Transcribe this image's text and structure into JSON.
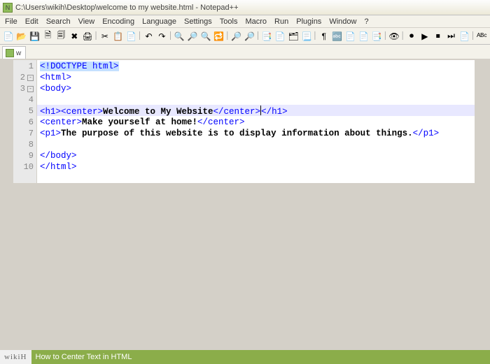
{
  "window": {
    "title": "C:\\Users\\wikih\\Desktop\\welcome to my website.html - Notepad++"
  },
  "menu": [
    "File",
    "Edit",
    "Search",
    "View",
    "Encoding",
    "Language",
    "Settings",
    "Tools",
    "Macro",
    "Run",
    "Plugins",
    "Window",
    "?"
  ],
  "toolbar_icons": [
    "📄",
    "📂",
    "💾",
    "🗎",
    "🗐",
    "✖",
    "🖨",
    "|",
    "✂",
    "📋",
    "📄",
    "|",
    "↶",
    "↷",
    "|",
    "🔍",
    "🔎",
    "🔍",
    "🔁",
    "|",
    "🔎",
    "🔎",
    "|",
    "📑",
    "📄",
    "🗂",
    "📃",
    "|",
    "¶",
    "🔤",
    "📄",
    "📄",
    "📑",
    "|",
    "👁",
    "|",
    "⏺",
    "▶",
    "⏹",
    "⏭",
    "📄",
    "|",
    "ᴬᴮᶜ"
  ],
  "tab": {
    "label": "w"
  },
  "gutter": {
    "lines": [
      "1",
      "2",
      "3",
      "4",
      "5",
      "6",
      "7",
      "8",
      "9",
      "10"
    ],
    "fold_rows": [
      1,
      2
    ],
    "fold_glyph": "-"
  },
  "code": {
    "active_row": 4,
    "rows": [
      [
        {
          "cls": "t-blue t-doctype",
          "txt": "<!DOCTYPE html>"
        }
      ],
      [
        {
          "cls": "t-blue",
          "txt": "<html>"
        }
      ],
      [
        {
          "cls": "t-blue",
          "txt": "<body>"
        }
      ],
      [],
      [
        {
          "cls": "t-blue",
          "txt": "<h1><center>"
        },
        {
          "cls": "t-black",
          "txt": "Welcome to My Website"
        },
        {
          "cls": "t-blue",
          "txt": "</center>"
        },
        {
          "caret": true
        },
        {
          "cls": "t-blue",
          "txt": "</h1>"
        }
      ],
      [
        {
          "cls": "t-blue",
          "txt": "<center>"
        },
        {
          "cls": "t-black",
          "txt": "Make yourself at home!"
        },
        {
          "cls": "t-blue",
          "txt": "</center>"
        }
      ],
      [
        {
          "cls": "t-blue",
          "txt": "<p1>"
        },
        {
          "cls": "t-black",
          "txt": "The purpose of this website is to display information about things."
        },
        {
          "cls": "t-blue",
          "txt": "</p1>"
        }
      ],
      [],
      [
        {
          "cls": "t-blue",
          "txt": "</body>"
        }
      ],
      [
        {
          "cls": "t-blue",
          "txt": "</html>"
        }
      ]
    ]
  },
  "footer": {
    "brand": "wikiH",
    "caption": "How to Center Text in HTML"
  }
}
